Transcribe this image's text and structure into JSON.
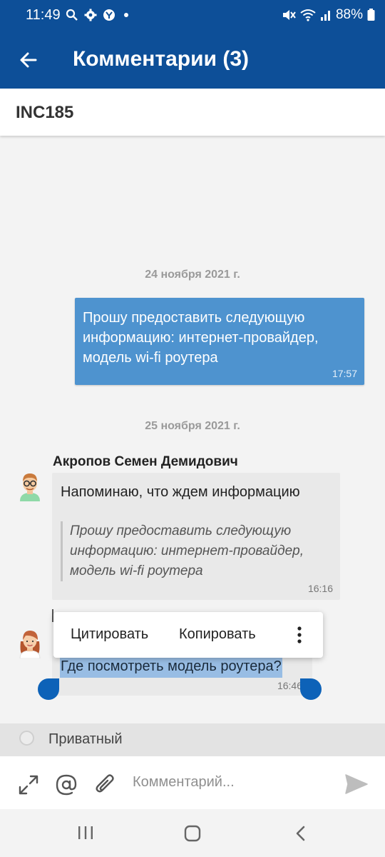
{
  "status_bar": {
    "time": "11:49",
    "battery": "88%",
    "left_icons": [
      "search-icon",
      "gear-icon",
      "yandex-icon",
      "dot-icon"
    ],
    "right_icons": [
      "mute-icon",
      "wifi-icon",
      "signal-icon",
      "battery-icon"
    ]
  },
  "app_bar": {
    "title": "Комментарии (3)",
    "back_icon": "arrow-left-icon"
  },
  "ticket": {
    "id": "INC185"
  },
  "chat": {
    "groups": [
      {
        "date": "24 ноября 2021 г.",
        "messages": [
          {
            "direction": "outgoing",
            "text": "Прошу предоставить следующую информацию: интернет-провайдер, модель wi-fi роутера",
            "time": "17:57"
          }
        ]
      },
      {
        "date": "25 ноября 2021 г.",
        "messages": [
          {
            "direction": "incoming",
            "author": "Акропов Семен Демидович",
            "text": "Напоминаю, что ждем информацию",
            "quote": "Прошу предоставить следующую информацию: интернет-провайдер, модель wi-fi роутера",
            "time": "16:16"
          },
          {
            "direction": "incoming",
            "text": "Где посмотреть модель роутера?",
            "time": "16:46",
            "selected": true
          }
        ]
      }
    ]
  },
  "context_menu": {
    "items": [
      "Цитировать",
      "Копировать"
    ],
    "more_icon": "more-vertical-icon"
  },
  "private_toggle": {
    "label": "Приватный",
    "checked": false
  },
  "composer": {
    "placeholder": "Комментарий...",
    "icons": [
      "expand-icon",
      "at-icon",
      "paperclip-icon",
      "send-icon"
    ]
  },
  "colors": {
    "primary": "#0d4f98",
    "outgoing_bubble": "#4e93cf",
    "incoming_bubble": "#e9e9e9",
    "selection": "#98bde4",
    "handle": "#0d62b8"
  }
}
